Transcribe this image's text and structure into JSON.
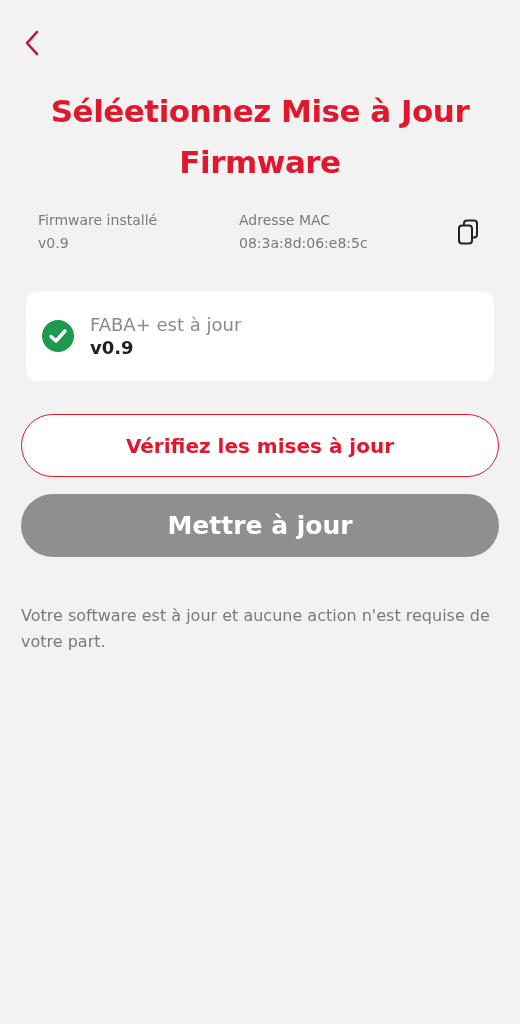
{
  "title": "Séléetionnez Mise à Jour Firmware",
  "info": [
    {
      "label": "Firmware installé",
      "value": "v0.9"
    },
    {
      "label": "Adresse MAC",
      "value": "08:3a:8d:06:e8:5c"
    }
  ],
  "status": {
    "message": "FABA+ est à jour",
    "version": "v0.9"
  },
  "buttons": [
    {
      "kind": "outline",
      "label": "Vérifiez les mises à jour",
      "disabled": false
    },
    {
      "kind": "filled",
      "label": "Mettre à jour",
      "disabled": true
    }
  ],
  "note": "Votre software est à jour et aucune action n'est requise de votre part."
}
